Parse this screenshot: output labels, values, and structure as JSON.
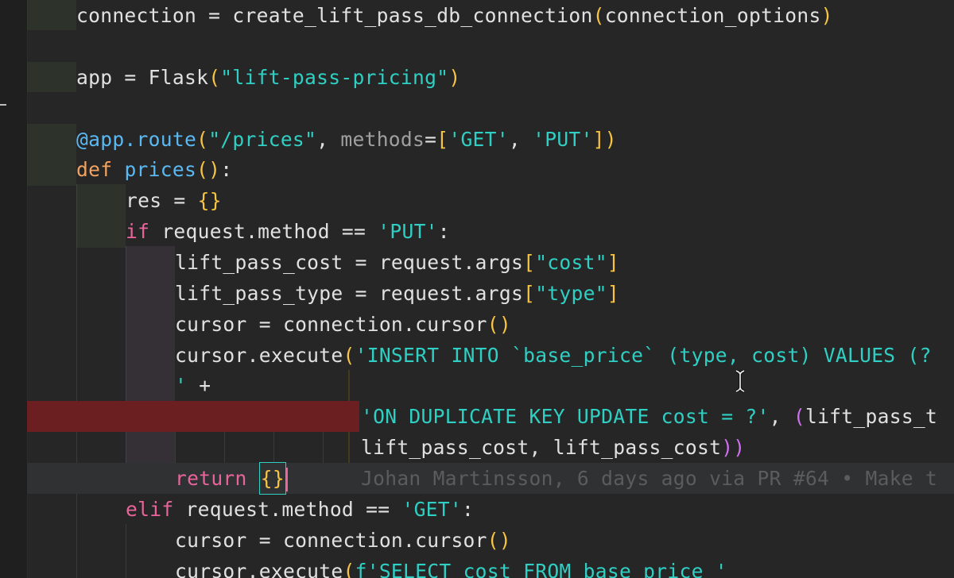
{
  "editor": {
    "language": "python",
    "lines": {
      "l1": {
        "a": "connection = create_lift_pass_db_connection",
        "b": "(",
        "c": "connection_options",
        "d": ")"
      },
      "l2": {
        "a": "app = Flask",
        "b": "(",
        "c": "\"lift-pass-pricing\"",
        "d": ")"
      },
      "l3": {
        "a": "@app.route",
        "b": "(",
        "c": "\"/prices\"",
        "d": ", ",
        "e": "methods",
        "f": "=",
        "g": "[",
        "h": "'GET'",
        "i": ", ",
        "j": "'PUT'",
        "k": "]",
        "l": ")"
      },
      "l4": {
        "a": "def ",
        "b": "prices",
        "c": "()",
        "d": ":"
      },
      "l5": {
        "a": "res = ",
        "b": "{}"
      },
      "l6": {
        "a": "if ",
        "b": "request.method == ",
        "c": "'PUT'",
        "d": ":"
      },
      "l7": {
        "a": "lift_pass_cost = request.args",
        "b": "[",
        "c": "\"cost\"",
        "d": "]"
      },
      "l8": {
        "a": "lift_pass_type = request.args",
        "b": "[",
        "c": "\"type\"",
        "d": "]"
      },
      "l9": {
        "a": "cursor = connection.cursor",
        "b": "()"
      },
      "l10": {
        "a": "cursor.execute",
        "b": "(",
        "c": "'INSERT INTO `base_price` (type, cost) VALUES (?"
      },
      "l11": {
        "a": "' ",
        "b": "+"
      },
      "l12": {
        "a": "'ON DUPLICATE KEY UPDATE cost = ?'",
        "b": ", ",
        "c": "(",
        "d": "lift_pass_t"
      },
      "l13": {
        "a": "lift_pass_cost, lift_pass_cost",
        "b": "))"
      },
      "l14": {
        "a": "return ",
        "b": "{}",
        "blame": "Johan Martinsson, 6 days ago via PR #64 • Make t"
      },
      "l15": {
        "a": "elif ",
        "b": "request.method == ",
        "c": "'GET'",
        "d": ":"
      },
      "l16": {
        "a": "cursor = connection.cursor",
        "b": "()"
      },
      "l17": {
        "a": "cursor.execute",
        "b": "(",
        "c": "f'SELECT cost FROM base_price '"
      }
    }
  },
  "colors": {
    "background": "#262627",
    "keyword": "#f0a35e",
    "control": "#e8649a",
    "function": "#5ab9f2",
    "string": "#2fd0c3",
    "bracket": "#f7c543",
    "error_highlight": "#6b1f21"
  }
}
